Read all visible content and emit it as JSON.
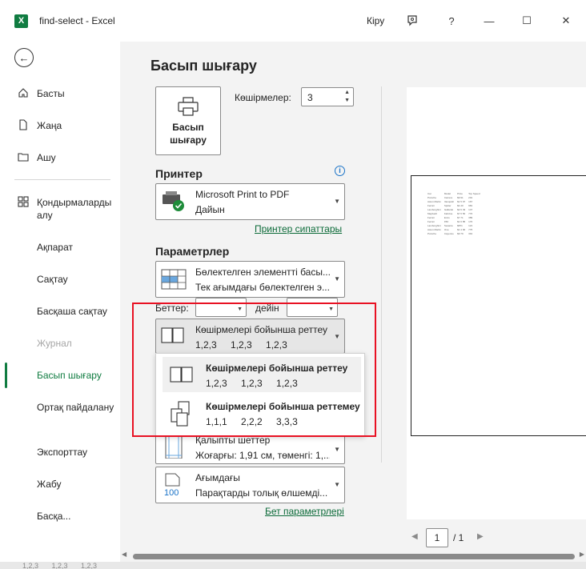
{
  "window": {
    "title": "find-select  -  Excel",
    "signin": "Кіру",
    "controls": {
      "help": "?",
      "minimize": "—",
      "maximize": "☐",
      "close": "✕"
    }
  },
  "nav": {
    "items": [
      {
        "label": "Басты",
        "icon": "home-icon"
      },
      {
        "label": "Жаңа",
        "icon": "new-file-icon"
      },
      {
        "label": "Ашу",
        "icon": "folder-icon"
      },
      {
        "label": "Қондырмаларды алу",
        "icon": "addins-icon"
      },
      {
        "label": "Ақпарат"
      },
      {
        "label": "Сақтау"
      },
      {
        "label": "Басқаша сақтау"
      },
      {
        "label": "Журнал",
        "disabled": true
      },
      {
        "label": "Басып шығару",
        "active": true
      },
      {
        "label": "Ортақ пайдалану"
      },
      {
        "label": "Экспорттау"
      },
      {
        "label": "Жабу"
      },
      {
        "label": "Басқа..."
      }
    ]
  },
  "main": {
    "title": "Басып шығару",
    "print_button": {
      "line1": "Басып",
      "line2": "шығару"
    },
    "copies": {
      "label": "Көшірмелер:",
      "value": "3"
    },
    "printer": {
      "heading": "Принтер",
      "name": "Microsoft Print to PDF",
      "status": "Дайын",
      "properties_link": "Принтер сипаттары"
    },
    "settings": {
      "heading": "Параметрлер",
      "scope_line1": "Бөлектелген элементті басы...",
      "scope_line2": "Тек ағымдағы бөлектелген э...",
      "pages_label": "Беттер:",
      "pages_to": "дейін",
      "collate_line1": "Көшірмелері бойынша реттеу",
      "collate_line2": "1,2,3  1,2,3  1,2,3",
      "popup": [
        {
          "title": "Көшірмелері бойынша реттеу",
          "sub": "1,2,3  1,2,3  1,2,3"
        },
        {
          "title": "Көшірмелері бойынша реттемеу",
          "sub": "1,1,1  2,2,2  3,3,3"
        }
      ],
      "margins_line1": "Қалыпты шеттер",
      "margins_line2": "Жоғарғы: 1,91 см, төменгі: 1,...",
      "scale_line1": "Ағымдағы",
      "scale_line2": "Парақтарды толық өлшемді...",
      "scale_icon_text": "100",
      "page_setup_link": "Бет параметрлері"
    },
    "preview": {
      "table": [
        [
          "Car",
          "Model",
          "Price",
          "Top Speed"
        ],
        [
          "Porsche",
          "Carrera",
          "$9 91",
          "201"
        ],
        [
          "Aston Martin",
          "Vanquish",
          "$1 5 97",
          "167"
        ],
        [
          "Ferrari",
          "Spider",
          "$4 40",
          "981"
        ],
        [
          "Lamborghini",
          "Gallardo",
          "$2 6 49",
          "147"
        ],
        [
          "Maybach",
          "Fall-line",
          "$7 6 50",
          "770"
        ],
        [
          "Ferrari",
          "Enzo",
          "$7 71",
          "389"
        ],
        [
          "Ferrari",
          "F50",
          "$1 6 85",
          "170"
        ],
        [
          "Lamborghini",
          "Sesanto",
          "$871",
          "121"
        ],
        [
          "Aston Martin",
          "One",
          "$1 4 90",
          "775"
        ],
        [
          "Porsche",
          "Cayenne",
          "$9 79",
          "391"
        ]
      ],
      "page_current": "1",
      "page_total": "/ 1"
    },
    "bottom_strip": "1,2,3  1,2,3  1,2,3"
  }
}
